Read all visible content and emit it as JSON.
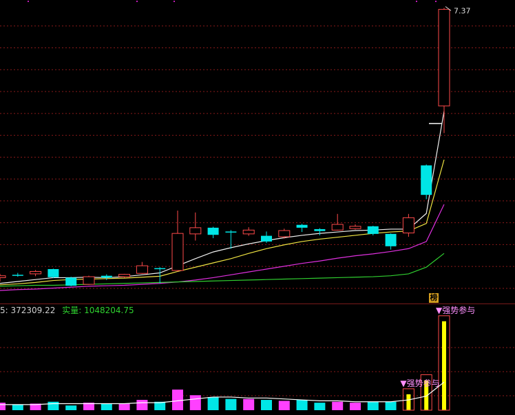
{
  "colors": {
    "up": "#ff4a4a",
    "down": "#00e6e6",
    "ma_white": "#f2f2f2",
    "ma_yellow": "#f0e442",
    "ma_magenta": "#e030e0",
    "ma_green": "#30d030",
    "grid": "#8b1a1a",
    "vol_yellow": "#ffff00",
    "vol_magenta": "#ff40ff"
  },
  "price_label": "7.37",
  "ticker_badge": "榜",
  "volume_header": {
    "prefix": "5: 372309.22",
    "real_label": "实量: 1048204.75"
  },
  "signals": [
    {
      "text": "▼强势参与",
      "bar_index": 23
    },
    {
      "text": "▼强势参与",
      "bar_index": 25
    }
  ],
  "chart_data": {
    "type": "candlestick",
    "title": "",
    "xlabel": "",
    "ylabel": "",
    "ylim": [
      1.2,
      7.45
    ],
    "annotations": [
      "7.37",
      "▼强势参与",
      "▼强势参与"
    ],
    "candles": [
      {
        "o": 1.7,
        "h": 1.78,
        "l": 1.62,
        "c": 1.74
      },
      {
        "o": 1.76,
        "h": 1.8,
        "l": 1.72,
        "c": 1.75
      },
      {
        "o": 1.78,
        "h": 1.86,
        "l": 1.73,
        "c": 1.83
      },
      {
        "o": 1.88,
        "h": 1.89,
        "l": 1.69,
        "c": 1.71
      },
      {
        "o": 1.7,
        "h": 1.72,
        "l": 1.52,
        "c": 1.53
      },
      {
        "o": 1.56,
        "h": 1.74,
        "l": 1.55,
        "c": 1.72
      },
      {
        "o": 1.74,
        "h": 1.77,
        "l": 1.65,
        "c": 1.7
      },
      {
        "o": 1.72,
        "h": 1.78,
        "l": 1.7,
        "c": 1.77
      },
      {
        "o": 1.79,
        "h": 2.03,
        "l": 1.78,
        "c": 1.95
      },
      {
        "o": 1.9,
        "h": 1.92,
        "l": 1.58,
        "c": 1.89
      },
      {
        "o": 1.85,
        "h": 3.11,
        "l": 1.83,
        "c": 2.63
      },
      {
        "o": 2.62,
        "h": 3.07,
        "l": 2.48,
        "c": 2.75
      },
      {
        "o": 2.75,
        "h": 2.77,
        "l": 2.53,
        "c": 2.6
      },
      {
        "o": 2.67,
        "h": 2.7,
        "l": 2.31,
        "c": 2.66
      },
      {
        "o": 2.62,
        "h": 2.76,
        "l": 2.58,
        "c": 2.7
      },
      {
        "o": 2.58,
        "h": 2.67,
        "l": 2.43,
        "c": 2.46
      },
      {
        "o": 2.56,
        "h": 2.73,
        "l": 2.52,
        "c": 2.69
      },
      {
        "o": 2.81,
        "h": 2.83,
        "l": 2.66,
        "c": 2.75
      },
      {
        "o": 2.72,
        "h": 2.74,
        "l": 2.59,
        "c": 2.68
      },
      {
        "o": 2.7,
        "h": 3.04,
        "l": 2.69,
        "c": 2.82
      },
      {
        "o": 2.73,
        "h": 2.82,
        "l": 2.71,
        "c": 2.78
      },
      {
        "o": 2.78,
        "h": 2.79,
        "l": 2.59,
        "c": 2.62
      },
      {
        "o": 2.62,
        "h": 2.63,
        "l": 2.29,
        "c": 2.36
      },
      {
        "o": 2.64,
        "h": 3.04,
        "l": 2.56,
        "c": 2.96
      },
      {
        "o": 4.06,
        "h": 4.08,
        "l": 3.35,
        "c": 3.44
      },
      {
        "o": 5.31,
        "h": 7.37,
        "l": 4.74,
        "c": 7.34
      }
    ],
    "ma_lines": [
      {
        "color_key": "ma_white",
        "values": [
          1.58,
          1.62,
          1.66,
          1.7,
          1.7,
          1.71,
          1.7,
          1.72,
          1.76,
          1.8,
          1.95,
          2.1,
          2.24,
          2.33,
          2.41,
          2.48,
          2.54,
          2.59,
          2.63,
          2.66,
          2.69,
          2.7,
          2.72,
          2.72,
          3.05,
          5.2
        ]
      },
      {
        "color_key": "ma_yellow",
        "values": [
          1.55,
          1.57,
          1.6,
          1.64,
          1.66,
          1.67,
          1.68,
          1.69,
          1.71,
          1.73,
          1.83,
          1.92,
          2.01,
          2.1,
          2.21,
          2.31,
          2.39,
          2.46,
          2.51,
          2.55,
          2.59,
          2.63,
          2.66,
          2.68,
          2.84,
          4.18
        ]
      },
      {
        "color_key": "ma_magenta",
        "values": [
          1.43,
          1.45,
          1.46,
          1.48,
          1.5,
          1.52,
          1.53,
          1.54,
          1.56,
          1.58,
          1.61,
          1.65,
          1.7,
          1.76,
          1.82,
          1.88,
          1.94,
          2.0,
          2.05,
          2.11,
          2.16,
          2.2,
          2.25,
          2.31,
          2.46,
          3.24
        ]
      },
      {
        "color_key": "ma_green",
        "values": [
          1.52,
          1.53,
          1.54,
          1.54,
          1.55,
          1.56,
          1.57,
          1.58,
          1.59,
          1.6,
          1.61,
          1.62,
          1.63,
          1.64,
          1.65,
          1.66,
          1.67,
          1.68,
          1.69,
          1.7,
          1.71,
          1.72,
          1.74,
          1.78,
          1.92,
          2.21
        ]
      }
    ],
    "volume": {
      "ylim": [
        0,
        100
      ],
      "values": [
        8,
        6,
        7,
        9,
        5,
        8,
        7,
        7,
        11,
        9,
        22,
        16,
        14,
        12,
        12,
        11,
        10,
        11,
        8,
        9,
        8,
        9,
        9,
        17,
        32,
        95
      ],
      "avg_line": [
        6,
        6,
        6,
        7,
        7,
        7,
        7,
        7,
        8,
        8,
        10,
        12,
        14,
        14,
        13,
        13,
        12,
        11,
        10,
        10,
        9,
        9,
        9,
        11,
        15,
        30
      ]
    }
  }
}
